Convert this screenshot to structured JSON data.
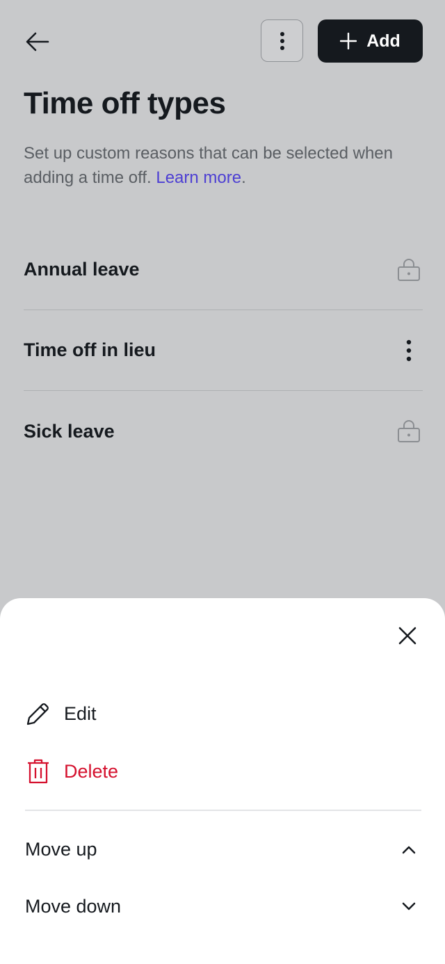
{
  "header": {
    "add_label": "Add"
  },
  "page": {
    "title": "Time off types",
    "description": "Set up custom reasons that can be selected when adding a time off.",
    "learn_more": "Learn more",
    "learn_more_suffix": "."
  },
  "types": [
    {
      "name": "Annual leave",
      "icon": "lock-icon"
    },
    {
      "name": "Time off in lieu",
      "icon": "more-vertical-icon"
    },
    {
      "name": "Sick leave",
      "icon": "lock-icon"
    }
  ],
  "sheet": {
    "edit_label": "Edit",
    "delete_label": "Delete",
    "move_up_label": "Move up",
    "move_down_label": "Move down"
  },
  "colors": {
    "overlay_background": "#c8c9cb",
    "primary_button": "#15191e",
    "link": "#4d3fd3",
    "danger": "#d5112e"
  }
}
